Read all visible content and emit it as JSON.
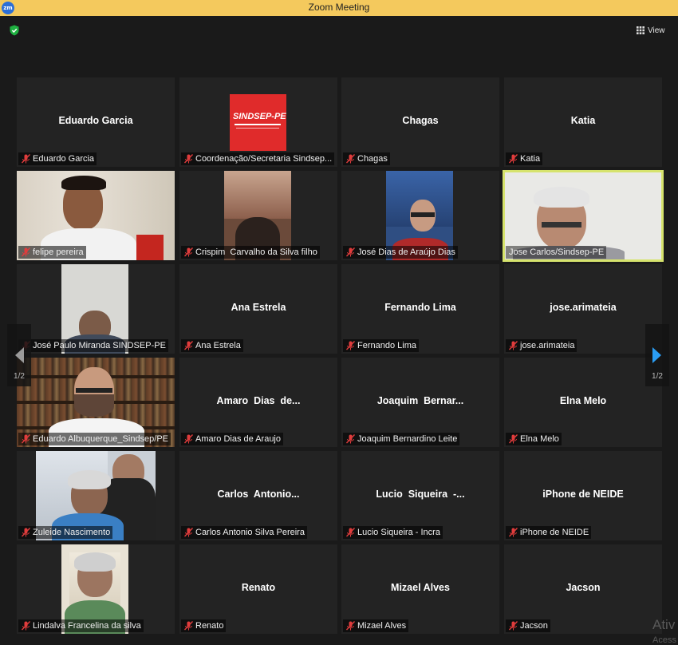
{
  "window": {
    "title": "Zoom Meeting",
    "app_icon": "zm"
  },
  "toolbar": {
    "view_label": "View"
  },
  "pagination": {
    "left": "1/2",
    "right": "1/2"
  },
  "watermark": {
    "line1": "Ativ",
    "line2": "Acess"
  },
  "colors": {
    "titlebar": "#f4c95d",
    "active_speaker": "#d6e36d",
    "muted": "#e03c3c",
    "nav_arrow_right": "#2a9df4"
  },
  "tiles": [
    {
      "center": "Eduardo Garcia",
      "label": "Eduardo Garcia"
    },
    {
      "center": "",
      "label": "Coordenação/Secretaria Sindsep...",
      "logo": "SINDSEP-PE"
    },
    {
      "center": "Chagas",
      "label": "Chagas"
    },
    {
      "center": "Katia",
      "label": "Katia"
    },
    {
      "center": "",
      "label": "felipe pereira"
    },
    {
      "center": "",
      "label": "Crispim  Carvalho da Silva filho"
    },
    {
      "center": "",
      "label": "José Dias de Araújo Dias"
    },
    {
      "center": "",
      "label": "Jose Carlos/Sindsep-PE"
    },
    {
      "center": "",
      "label": "José Paulo Miranda SINDSEP-PE"
    },
    {
      "center": "Ana Estrela",
      "label": "Ana Estrela"
    },
    {
      "center": "Fernando Lima",
      "label": "Fernando Lima"
    },
    {
      "center": "jose.arimateia",
      "label": "jose.arimateia"
    },
    {
      "center": "",
      "label": "Eduardo Albuquerque_Sindsep/PE"
    },
    {
      "center": "Amaro  Dias  de...",
      "label": "Amaro Dias de Araujo"
    },
    {
      "center": "Joaquim  Bernar...",
      "label": "Joaquim Bernardino Leite"
    },
    {
      "center": "Elna Melo",
      "label": "Elna Melo"
    },
    {
      "center": "",
      "label": "Zuleide Nascimento"
    },
    {
      "center": "Carlos  Antonio...",
      "label": "Carlos Antonio Silva Pereira"
    },
    {
      "center": "Lucio  Siqueira  -...",
      "label": "Lucio Siqueira - Incra"
    },
    {
      "center": "iPhone de NEIDE",
      "label": "iPhone de NEIDE"
    },
    {
      "center": "",
      "label": "Lindalva Francelina da silva"
    },
    {
      "center": "Renato",
      "label": "Renato"
    },
    {
      "center": "Mizael Alves",
      "label": "Mizael Alves"
    },
    {
      "center": "Jacson",
      "label": "Jacson"
    }
  ]
}
